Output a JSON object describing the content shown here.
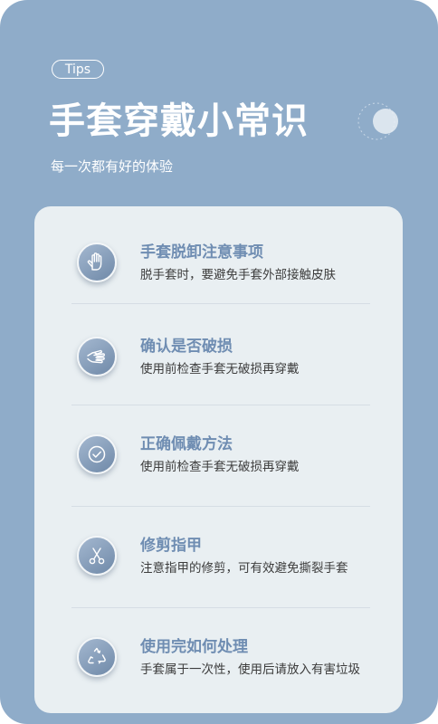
{
  "header": {
    "tag": "Tips",
    "title": "手套穿戴小常识",
    "subtitle": "每一次都有好的体验"
  },
  "tips": [
    {
      "icon": "raised-hand-icon",
      "title": "手套脱卸注意事项",
      "description": "脱手套时，要避免手套外部接触皮肤"
    },
    {
      "icon": "palm-hand-icon",
      "title": "确认是否破损",
      "description": "使用前检查手套无破损再穿戴"
    },
    {
      "icon": "check-circle-icon",
      "title": "正确佩戴方法",
      "description": "使用前检查手套无破损再穿戴"
    },
    {
      "icon": "scissors-icon",
      "title": "修剪指甲",
      "description": "注意指甲的修剪，可有效避免撕裂手套"
    },
    {
      "icon": "recycle-icon",
      "title": "使用完如何处理",
      "description": "手套属于一次性，使用后请放入有害垃圾"
    }
  ],
  "colors": {
    "background": "#8facc9",
    "card": "#e9eff2",
    "accent": "#6f8db2",
    "text": "#3c3c3c"
  }
}
